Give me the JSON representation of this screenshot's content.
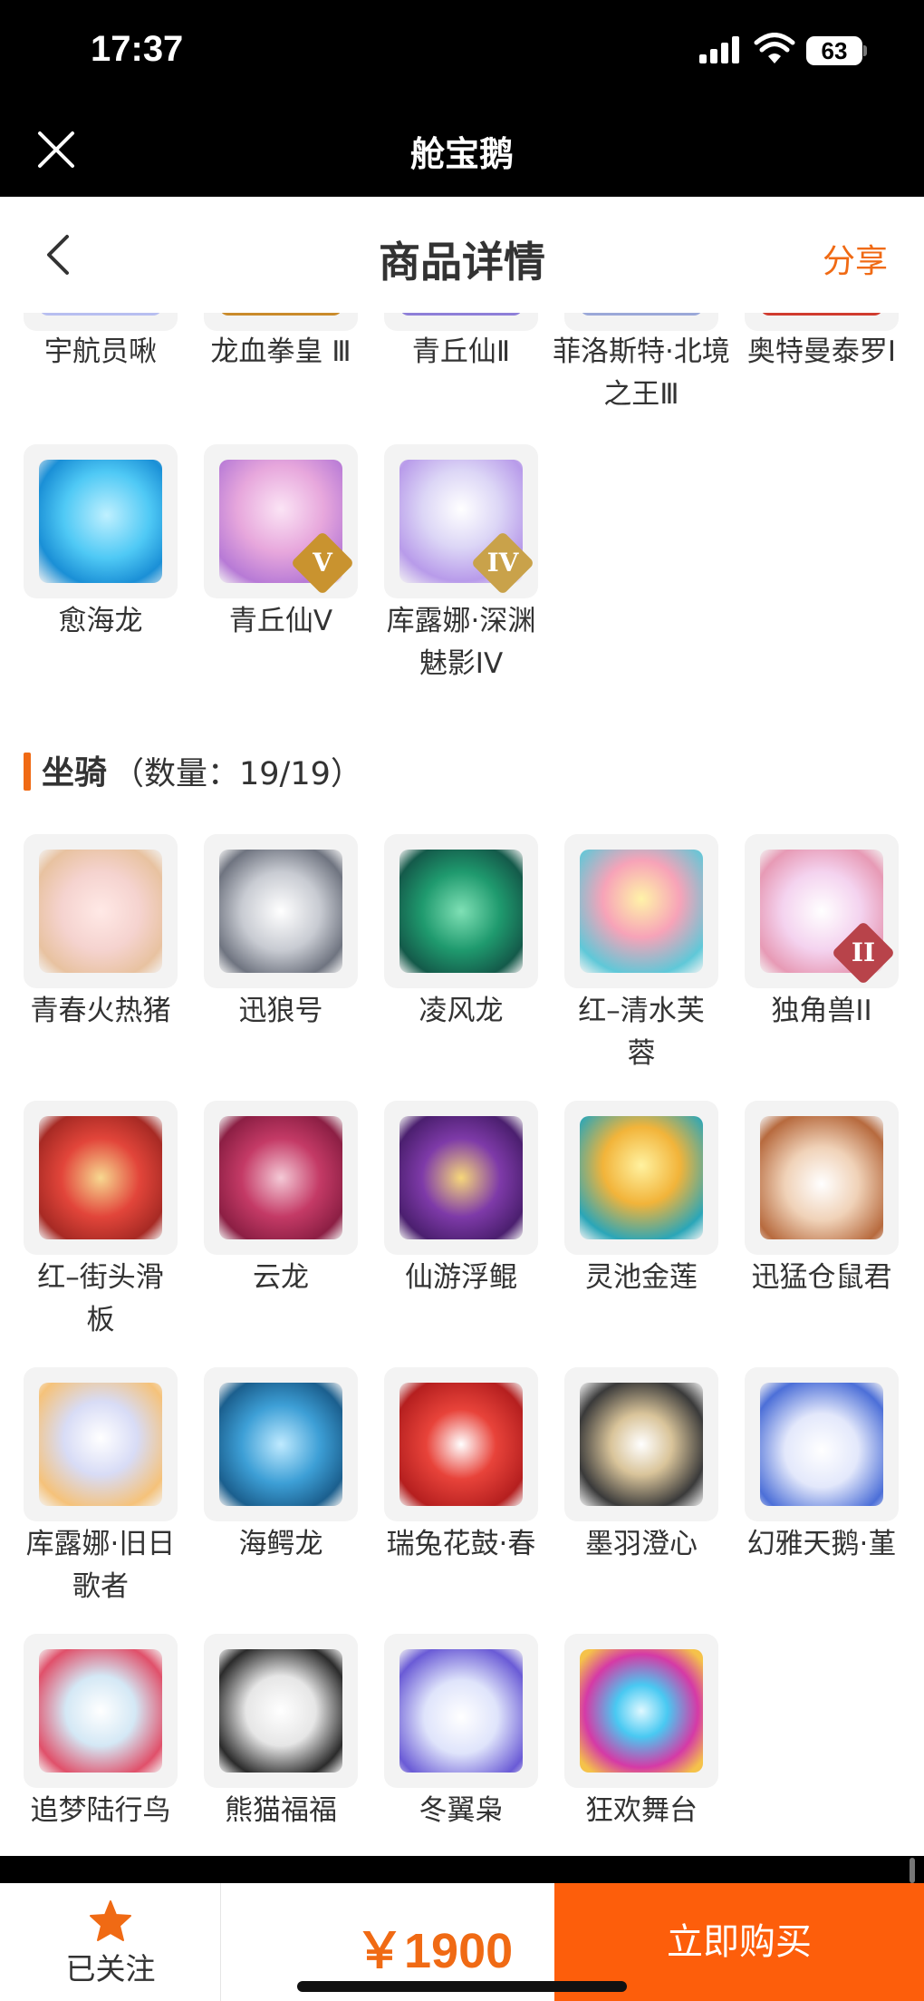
{
  "status_bar": {
    "time": "17:37",
    "battery": "63"
  },
  "app_bar": {
    "title": "舱宝鹅"
  },
  "header": {
    "title": "商品详情",
    "share": "分享"
  },
  "partial_row_names": [
    "宇航员啾",
    "龙血拳皇 Ⅲ",
    "青丘仙Ⅱ",
    "菲洛斯特·北境之王Ⅲ",
    "奥特曼泰罗Ⅰ"
  ],
  "pet_row": [
    {
      "name": "愈海龙",
      "icon": "ice-dragon-icon",
      "badge": ""
    },
    {
      "name": "青丘仙V",
      "icon": "fox-fairy-icon",
      "badge": "V"
    },
    {
      "name": "库露娜·深渊魅影IV",
      "icon": "abyss-mermaid-icon",
      "badge": "IV"
    }
  ],
  "section": {
    "title": "坐骑",
    "count_text": "（数量：19/19）"
  },
  "mounts": [
    {
      "name": "青春火热猪",
      "icon": "pig-icon",
      "badge": ""
    },
    {
      "name": "迅狼号",
      "icon": "mecha-wolf-icon",
      "badge": ""
    },
    {
      "name": "凌风龙",
      "icon": "green-dragon-icon",
      "badge": ""
    },
    {
      "name": "红–清水芙蓉",
      "icon": "lotus-icon",
      "badge": ""
    },
    {
      "name": "独角兽II",
      "icon": "unicorn-icon",
      "badge": "II"
    },
    {
      "name": "红–街头滑板",
      "icon": "skateboard-icon",
      "badge": ""
    },
    {
      "name": "云龙",
      "icon": "cloud-dragon-icon",
      "badge": ""
    },
    {
      "name": "仙游浮鲲",
      "icon": "flying-fish-icon",
      "badge": ""
    },
    {
      "name": "灵池金莲",
      "icon": "golden-lotus-icon",
      "badge": ""
    },
    {
      "name": "迅猛仓鼠君",
      "icon": "hamster-icon",
      "badge": ""
    },
    {
      "name": "库露娜·旧日歌者",
      "icon": "singer-mermaid-icon",
      "badge": ""
    },
    {
      "name": "海鳄龙",
      "icon": "sea-dragon-icon",
      "badge": ""
    },
    {
      "name": "瑞兔花鼓·春",
      "icon": "rabbit-drum-icon",
      "badge": ""
    },
    {
      "name": "墨羽澄心",
      "icon": "feather-blade-icon",
      "badge": ""
    },
    {
      "name": "幻雅天鹅·堇",
      "icon": "swan-icon",
      "badge": ""
    },
    {
      "name": "追梦陆行鸟",
      "icon": "dodo-bird-icon",
      "badge": ""
    },
    {
      "name": "熊猫福福",
      "icon": "panda-icon",
      "badge": ""
    },
    {
      "name": "冬翼枭",
      "icon": "owl-icon",
      "badge": ""
    },
    {
      "name": "狂欢舞台",
      "icon": "heart-stage-icon",
      "badge": ""
    }
  ],
  "bottom_bar": {
    "follow_label": "已关注",
    "price": "￥1900",
    "buy_label": "立即购买"
  },
  "colors": {
    "accent": "#f06a14",
    "buy_button": "#fd5e0b",
    "tile_bg": "#f3f3f3"
  }
}
